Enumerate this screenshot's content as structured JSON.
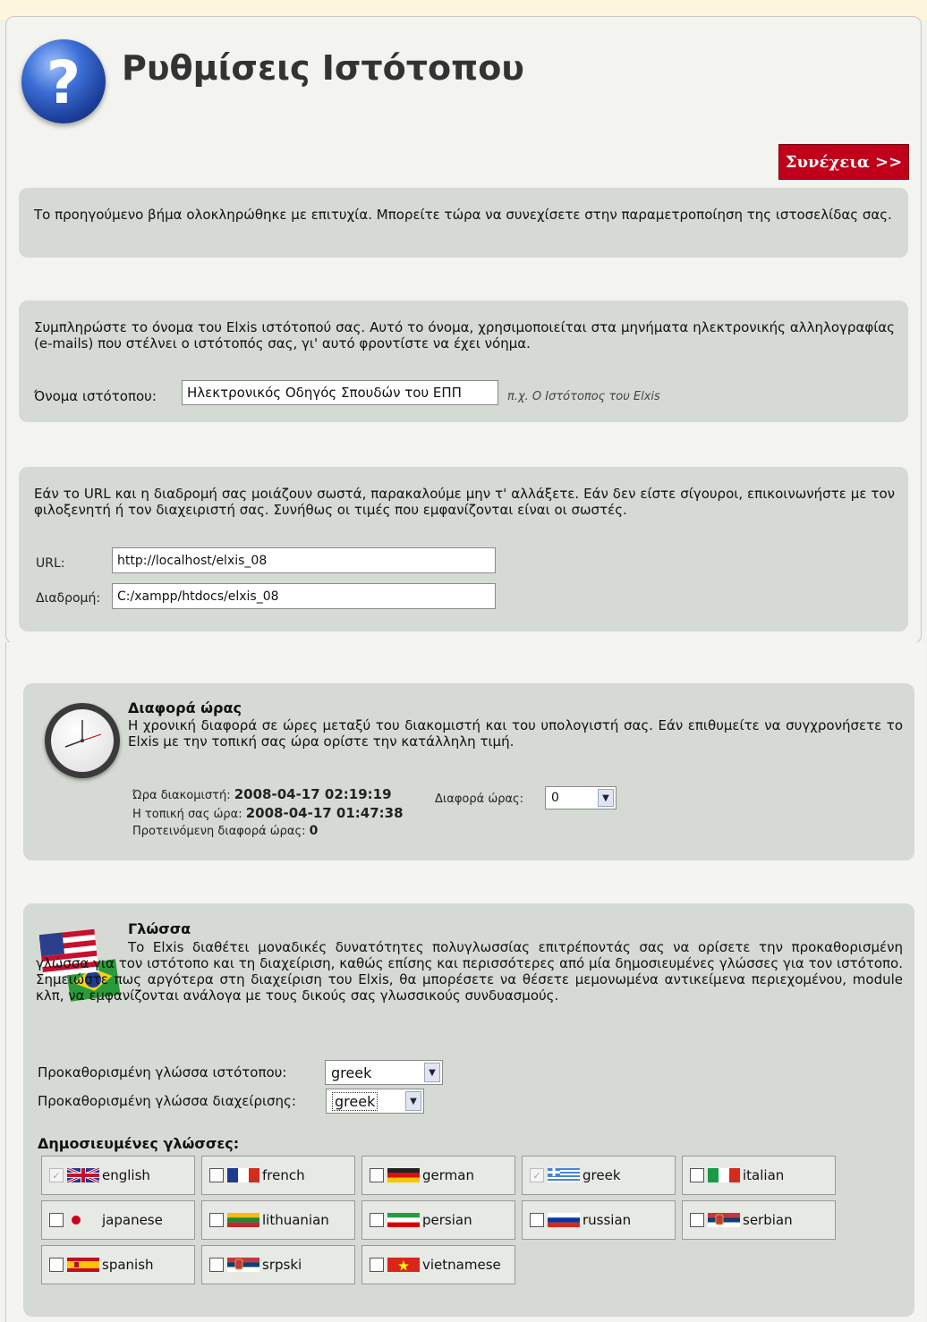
{
  "page": {
    "title": "Ρυθμίσεις Ιστότοπου",
    "help_icon_glyph": "?",
    "next_button": "Συνέχεια >>"
  },
  "intro": {
    "text": "Το προηγούμενο βήμα ολοκληρώθηκε με επιτυχία. Μπορείτε τώρα να συνεχίσετε στην παραμετροποίηση της ιστοσελίδας σας."
  },
  "sitename": {
    "text": "Συμπληρώστε το όνομα του Elxis ιστότοπού σας. Αυτό το όνομα, χρησιμοποιείται στα μηνήματα ηλεκτρονικής αλληλογραφίας (e-mails) που στέλνει ο ιστότοπός σας, γι' αυτό φροντίστε να έχει νόημα.",
    "label": "Όνομα ιστότοπου:",
    "value": "Ηλεκτρονικός Οδηγός Σπουδών του ΕΠΠ",
    "example": "π.χ. Ο Ιστότοπος του Elxis"
  },
  "paths": {
    "text": "Εάν το URL και η διαδρομή σας μοιάζουν σωστά, παρακαλούμε μην τ' αλλάξετε. Εάν δεν είστε σίγουροι, επικοινωνήστε με τον φιλοξενητή ή τον διαχειριστή σας. Συνήθως οι τιμές που εμφανίζονται είναι οι σωστές.",
    "url_label": "URL:",
    "url_value": "http://localhost/elxis_08",
    "path_label": "Διαδρομή:",
    "path_value": "C:/xampp/htdocs/elxis_08"
  },
  "time": {
    "heading": "Διαφορά ώρας",
    "text": "Η χρονική διαφορά σε ώρες μεταξύ του διακομιστή και του υπολογιστή σας. Εάν επιθυμείτε να συγχρονήσετε το Elxis με την τοπική σας ώρα ορίστε την κατάλληλη τιμή.",
    "server_label": "Ώρα διακομιστή:",
    "server_value": "2008-04-17 02:19:19",
    "local_label": "Η τοπική σας ώρα:",
    "local_value": "2008-04-17 01:47:38",
    "suggested_label": "Προτεινόμενη διαφορά ώρας:",
    "suggested_value": "0",
    "offset_label": "Διαφορά ώρας:",
    "offset_value": "0"
  },
  "language": {
    "heading": "Γλώσσα",
    "text": "Το Elxis διαθέτει μοναδικές δυνατότητες πολυγλωσσίας επιτρέποντάς σας να ορίσετε την προκαθορισμένη γλώσσα για τον ιστότοπο και τη διαχείριση, καθώς επίσης και περισσότερες από μία δημοσιευμένες γλώσσες για τον ιστότοπο. Σημειώστε πως αργότερα στη διαχείριση του Elxis, θα μπορέσετε να θέσετε μεμονωμένα αντικείμενα περιεχομένου, module κλπ, να εμφανίζονται ανάλογα με τους δικούς σας γλωσσικούς συνδυασμούς.",
    "site_lang_label": "Προκαθορισμένη γλώσσα ιστότοπου:",
    "site_lang_value": "greek",
    "admin_lang_label": "Προκαθορισμένη γλώσσα διαχείρισης:",
    "admin_lang_value": "greek",
    "published_heading": "Δημοσιευμένες γλώσσες:",
    "languages": [
      {
        "name": "english",
        "checked": true,
        "disabled": true,
        "flag": "uk-flag"
      },
      {
        "name": "french",
        "checked": false,
        "disabled": false,
        "flag": "france-flag"
      },
      {
        "name": "german",
        "checked": false,
        "disabled": false,
        "flag": "germany-flag"
      },
      {
        "name": "greek",
        "checked": true,
        "disabled": true,
        "flag": "greece-flag"
      },
      {
        "name": "italian",
        "checked": false,
        "disabled": false,
        "flag": "italy-flag"
      },
      {
        "name": "japanese",
        "checked": false,
        "disabled": false,
        "flag": "japan-flag"
      },
      {
        "name": "lithuanian",
        "checked": false,
        "disabled": false,
        "flag": "lithuania-flag"
      },
      {
        "name": "persian",
        "checked": false,
        "disabled": false,
        "flag": "iran-flag"
      },
      {
        "name": "russian",
        "checked": false,
        "disabled": false,
        "flag": "russia-flag"
      },
      {
        "name": "serbian",
        "checked": false,
        "disabled": false,
        "flag": "serbia-flag"
      },
      {
        "name": "spanish",
        "checked": false,
        "disabled": false,
        "flag": "spain-flag"
      },
      {
        "name": "srpski",
        "checked": false,
        "disabled": false,
        "flag": "serbia-flag"
      },
      {
        "name": "vietnamese",
        "checked": false,
        "disabled": false,
        "flag": "vietnam-flag"
      }
    ]
  },
  "colors": {
    "accent_button": "#c0001a",
    "panel": "#d6dad4",
    "background": "#f2f2ee"
  }
}
